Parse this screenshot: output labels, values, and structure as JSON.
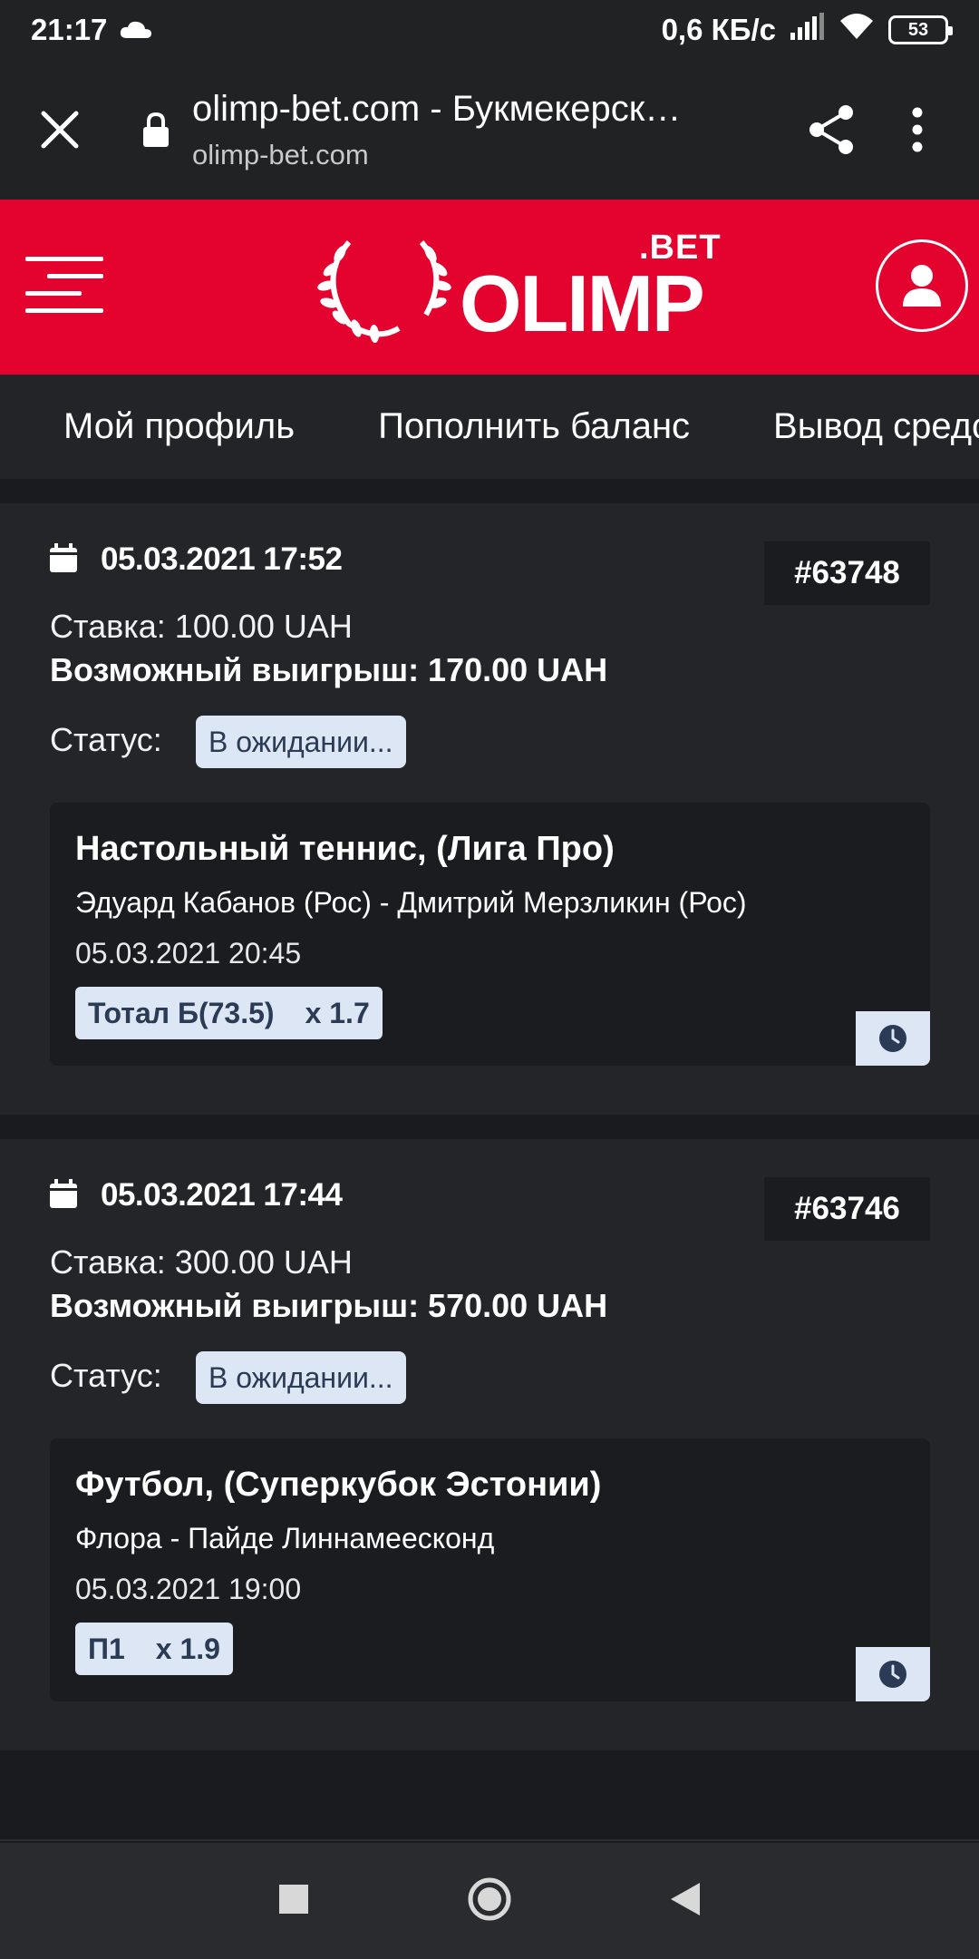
{
  "status_bar": {
    "time": "21:17",
    "network_speed": "0,6 КБ/с",
    "battery": "53"
  },
  "browser": {
    "title": "olimp-bet.com - Букмекерск…",
    "url": "olimp-bet.com"
  },
  "header": {
    "logo_bet": ".BET",
    "logo_name": "OLIMP"
  },
  "tabs": [
    {
      "label": "Мой профиль"
    },
    {
      "label": "Пополнить баланс"
    },
    {
      "label": "Вывод средств"
    }
  ],
  "bets": [
    {
      "date": "05.03.2021 17:52",
      "id": "#63748",
      "stake": "Ставка: 100.00 UAH",
      "possible_win": "Возможный выигрыш: 170.00 UAH",
      "status_label": "Статус:",
      "status": "В ожидании...",
      "event": {
        "sport": "Настольный теннис, (Лига Про)",
        "teams": "Эдуард Кабанов (Рос) - Дмитрий Мерзликин (Рос)",
        "time": "05.03.2021 20:45",
        "market": "Тотал Б(73.5)",
        "odds": "x 1.7"
      }
    },
    {
      "date": "05.03.2021 17:44",
      "id": "#63746",
      "stake": "Ставка: 300.00 UAH",
      "possible_win": "Возможный выигрыш: 570.00 UAH",
      "status_label": "Статус:",
      "status": "В ожидании...",
      "event": {
        "sport": "Футбол, (Суперкубок Эстонии)",
        "teams": "Флора - Пайде Линнамеесконд",
        "time": "05.03.2021 19:00",
        "market": "П1",
        "odds": "x 1.9"
      }
    }
  ],
  "colors": {
    "brand_red": "#e4032e",
    "badge_bg": "#dce6f4",
    "page_bg": "#1a1b1e"
  }
}
